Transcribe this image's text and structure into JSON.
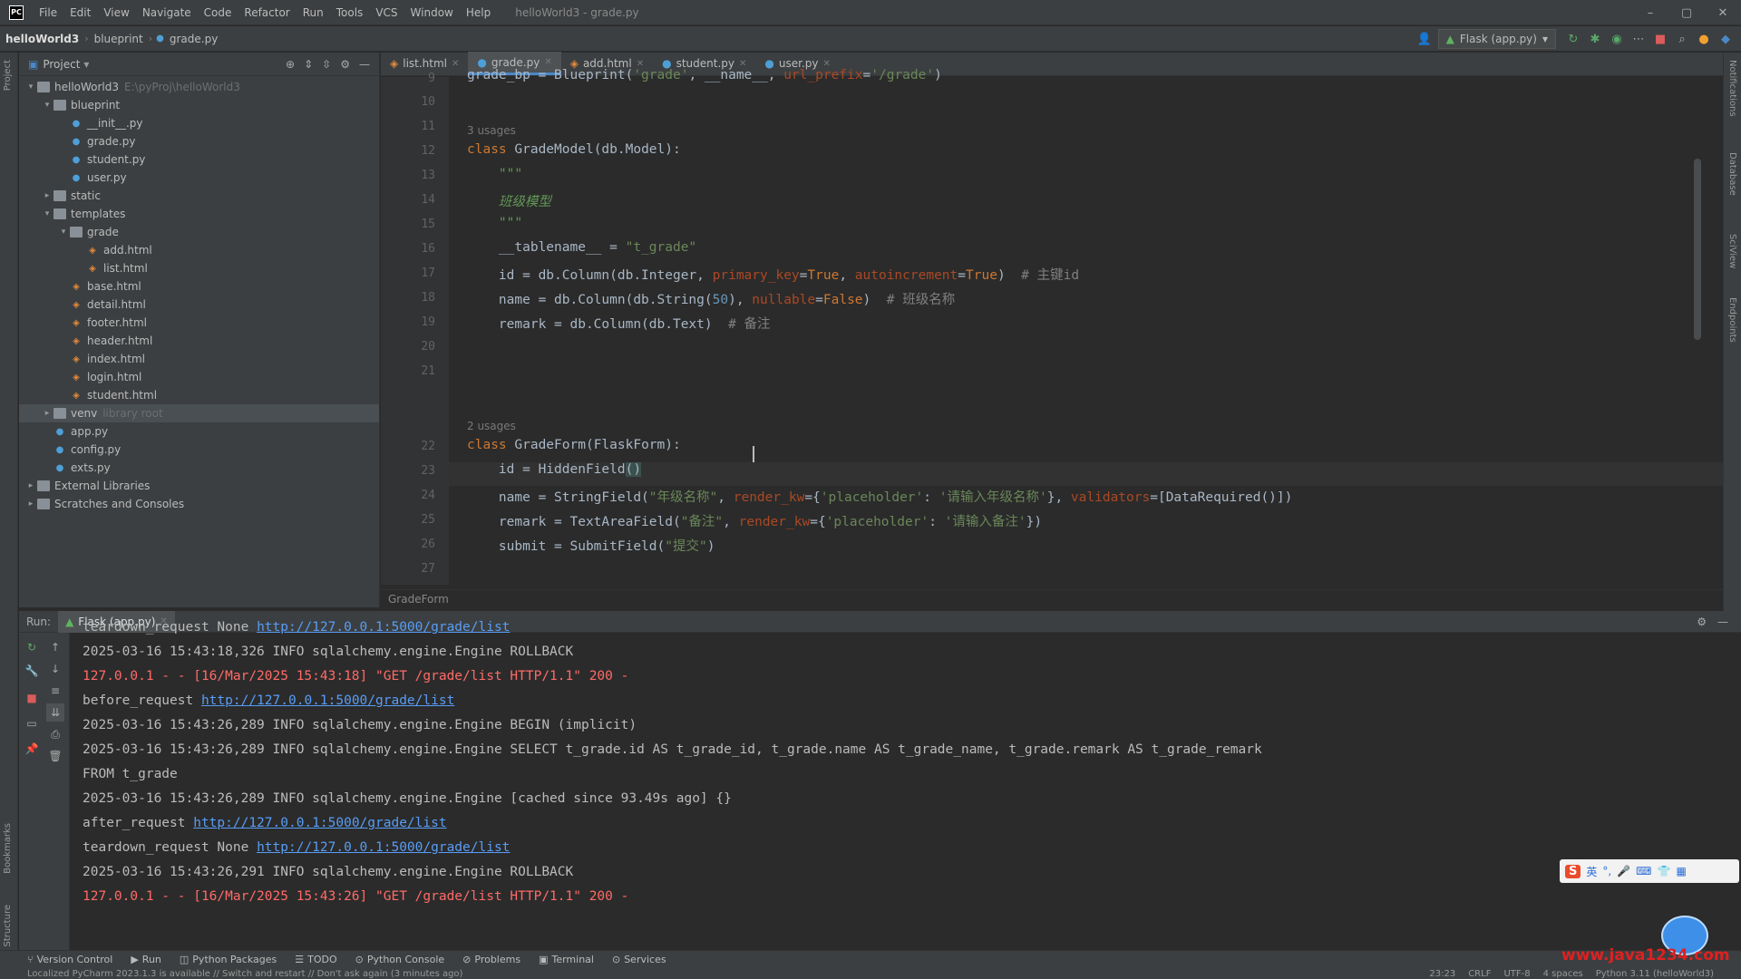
{
  "window": {
    "title": "helloWorld3 - grade.py",
    "menu": [
      "File",
      "Edit",
      "View",
      "Navigate",
      "Code",
      "Refactor",
      "Run",
      "Tools",
      "VCS",
      "Window",
      "Help"
    ],
    "controls": [
      "–",
      "▢",
      "✕"
    ]
  },
  "breadcrumb": [
    "helloWorld3",
    "blueprint",
    "grade.py"
  ],
  "toolbar": {
    "run_config": "Flask (app.py)"
  },
  "project": {
    "header": "Project",
    "tree": [
      {
        "label": "helloWorld3",
        "hint": "E:\\pyProj\\helloWorld3",
        "type": "folder",
        "indent": 0,
        "open": true
      },
      {
        "label": "blueprint",
        "type": "folder",
        "indent": 1,
        "open": true
      },
      {
        "label": "__init__.py",
        "type": "py",
        "indent": 2
      },
      {
        "label": "grade.py",
        "type": "py",
        "indent": 2
      },
      {
        "label": "student.py",
        "type": "py",
        "indent": 2
      },
      {
        "label": "user.py",
        "type": "py",
        "indent": 2
      },
      {
        "label": "static",
        "type": "folder",
        "indent": 1,
        "open": false
      },
      {
        "label": "templates",
        "type": "folder",
        "indent": 1,
        "open": true
      },
      {
        "label": "grade",
        "type": "folder",
        "indent": 2,
        "open": true
      },
      {
        "label": "add.html",
        "type": "html",
        "indent": 3
      },
      {
        "label": "list.html",
        "type": "html",
        "indent": 3
      },
      {
        "label": "base.html",
        "type": "html",
        "indent": 2
      },
      {
        "label": "detail.html",
        "type": "html",
        "indent": 2
      },
      {
        "label": "footer.html",
        "type": "html",
        "indent": 2
      },
      {
        "label": "header.html",
        "type": "html",
        "indent": 2
      },
      {
        "label": "index.html",
        "type": "html",
        "indent": 2
      },
      {
        "label": "login.html",
        "type": "html",
        "indent": 2
      },
      {
        "label": "student.html",
        "type": "html",
        "indent": 2
      },
      {
        "label": "venv",
        "hint": "library root",
        "type": "folder",
        "indent": 1,
        "open": false,
        "selected": true
      },
      {
        "label": "app.py",
        "type": "py",
        "indent": 1
      },
      {
        "label": "config.py",
        "type": "py",
        "indent": 1
      },
      {
        "label": "exts.py",
        "type": "py",
        "indent": 1
      },
      {
        "label": "External Libraries",
        "type": "folder",
        "indent": 0,
        "open": false
      },
      {
        "label": "Scratches and Consoles",
        "type": "folder",
        "indent": 0,
        "open": false
      }
    ]
  },
  "tabs": [
    {
      "label": "list.html",
      "type": "html"
    },
    {
      "label": "grade.py",
      "type": "py",
      "active": true
    },
    {
      "label": "add.html",
      "type": "html"
    },
    {
      "label": "student.py",
      "type": "py"
    },
    {
      "label": "user.py",
      "type": "py"
    }
  ],
  "editor": {
    "line_numbers": [
      "9",
      "10",
      "11",
      "12",
      "13",
      "14",
      "15",
      "16",
      "17",
      "18",
      "19",
      "20",
      "21",
      "22",
      "23",
      "24",
      "25",
      "26",
      "27"
    ],
    "usages_1": "3 usages",
    "usages_2": "2 usages",
    "breadcrumb": "GradeForm",
    "code": {
      "l9_a": "grade_bp = Blueprint(",
      "l9_b": "'grade'",
      "l9_c": ", __name__, ",
      "l9_d": "url_prefix",
      "l9_e": "=",
      "l9_f": "'/grade'",
      "l9_g": ")",
      "l12_a": "class ",
      "l12_b": "GradeModel(db.Model):",
      "l13": "    \"\"\"",
      "l14": "    班级模型",
      "l15": "    \"\"\"",
      "l16_a": "    __tablename__ = ",
      "l16_b": "\"t_grade\"",
      "l17_a": "    id = db.Column(db.Integer, ",
      "l17_b": "primary_key",
      "l17_c": "=",
      "l17_d": "True",
      "l17_e": ", ",
      "l17_f": "autoincrement",
      "l17_g": "=",
      "l17_h": "True",
      "l17_i": ")  ",
      "l17_j": "# 主键id",
      "l18_a": "    name = db.Column(db.String(",
      "l18_b": "50",
      "l18_c": "), ",
      "l18_d": "nullable",
      "l18_e": "=",
      "l18_f": "False",
      "l18_g": ")  ",
      "l18_h": "# 班级名称",
      "l19_a": "    remark = db.Column(db.Text)  ",
      "l19_b": "# 备注",
      "l22_a": "class ",
      "l22_b": "GradeForm(FlaskForm):",
      "l23_a": "    id = HiddenField",
      "l23_b": "()",
      "l24_a": "    name = StringField(",
      "l24_b": "\"年级名称\"",
      "l24_c": ", ",
      "l24_d": "render_kw",
      "l24_e": "={",
      "l24_f": "'placeholder'",
      "l24_g": ": ",
      "l24_h": "'请输入年级名称'",
      "l24_i": "}, ",
      "l24_j": "validators",
      "l24_k": "=[DataRequired()])",
      "l25_a": "    remark = TextAreaField(",
      "l25_b": "\"备注\"",
      "l25_c": ", ",
      "l25_d": "render_kw",
      "l25_e": "={",
      "l25_f": "'placeholder'",
      "l25_g": ": ",
      "l25_h": "'请输入备注'",
      "l25_i": "})",
      "l26_a": "    submit = SubmitField(",
      "l26_b": "\"提交\"",
      "l26_c": ")"
    }
  },
  "run": {
    "label": "Run:",
    "tab": "Flask (app.py)",
    "lines": [
      {
        "text": "teardown_request None ",
        "link": "http://127.0.0.1:5000/grade/list",
        "cls": "plain"
      },
      {
        "text": "2025-03-16 15:43:18,326 INFO sqlalchemy.engine.Engine ROLLBACK",
        "cls": "plain"
      },
      {
        "text": "127.0.0.1 - - [16/Mar/2025 15:43:18] \"GET /grade/list HTTP/1.1\" 200 -",
        "cls": "red"
      },
      {
        "text": "before_request ",
        "link": "http://127.0.0.1:5000/grade/list",
        "cls": "plain"
      },
      {
        "text": "2025-03-16 15:43:26,289 INFO sqlalchemy.engine.Engine BEGIN (implicit)",
        "cls": "plain"
      },
      {
        "text": "2025-03-16 15:43:26,289 INFO sqlalchemy.engine.Engine SELECT t_grade.id AS t_grade_id, t_grade.name AS t_grade_name, t_grade.remark AS t_grade_remark",
        "cls": "plain"
      },
      {
        "text": "FROM t_grade",
        "cls": "plain"
      },
      {
        "text": "2025-03-16 15:43:26,289 INFO sqlalchemy.engine.Engine [cached since 93.49s ago] {}",
        "cls": "plain"
      },
      {
        "text": "after_request ",
        "link": "http://127.0.0.1:5000/grade/list",
        "cls": "plain"
      },
      {
        "text": "teardown_request None ",
        "link": "http://127.0.0.1:5000/grade/list",
        "cls": "plain"
      },
      {
        "text": "2025-03-16 15:43:26,291 INFO sqlalchemy.engine.Engine ROLLBACK",
        "cls": "plain"
      },
      {
        "text": "127.0.0.1 - - [16/Mar/2025 15:43:26] \"GET /grade/list HTTP/1.1\" 200 -",
        "cls": "red"
      }
    ]
  },
  "toolwindows": [
    "Version Control",
    "Run",
    "Python Packages",
    "TODO",
    "Python Console",
    "Problems",
    "Terminal",
    "Services"
  ],
  "status": {
    "message": "Localized PyCharm 2023.1.3 is available // Switch and restart // Don't ask again (3 minutes ago)",
    "position": "23:23",
    "line_sep": "CRLF",
    "encoding": "UTF-8",
    "indent": "4 spaces",
    "interpreter": "Python 3.11 (helloWorld3)"
  },
  "watermark": "www.java1234.com",
  "colors": {
    "accent": "#4a88c7",
    "error": "#ff6b68",
    "link": "#589df6"
  }
}
